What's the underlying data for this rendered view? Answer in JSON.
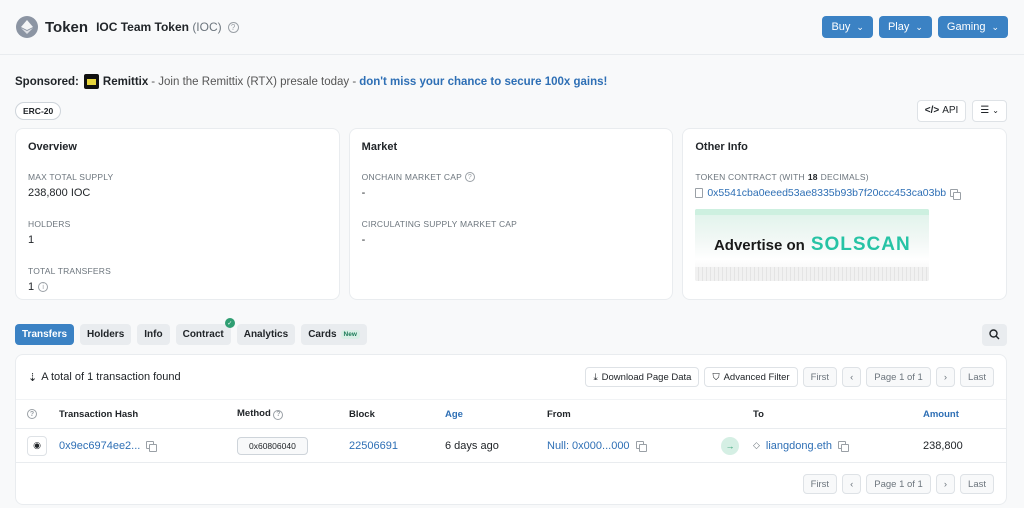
{
  "header": {
    "title": "Token",
    "token_name": "IOC Team Token",
    "symbol": "(IOC)",
    "buttons": [
      "Buy",
      "Play",
      "Gaming"
    ]
  },
  "sponsored": {
    "label": "Sponsored:",
    "brand": "Remittix",
    "text": "- Join the Remittix (RTX) presale today -",
    "link": "don't miss your chance to secure 100x gains!"
  },
  "badges": {
    "standard": "ERC-20",
    "api": "API"
  },
  "overview": {
    "title": "Overview",
    "max_supply_label": "MAX TOTAL SUPPLY",
    "max_supply": "238,800 IOC",
    "holders_label": "HOLDERS",
    "holders": "1",
    "transfers_label": "TOTAL TRANSFERS",
    "transfers": "1"
  },
  "market": {
    "title": "Market",
    "onchain_label": "ONCHAIN MARKET CAP",
    "onchain": "-",
    "circ_label": "CIRCULATING SUPPLY MARKET CAP",
    "circ": "-"
  },
  "other": {
    "title": "Other Info",
    "contract_label_pre": "TOKEN CONTRACT (WITH",
    "decimals": "18",
    "contract_label_post": "DECIMALS)",
    "contract": "0x5541cba0eeed53ae8335b93b7f20ccc453ca03bb",
    "ad_text": "Advertise on",
    "ad_brand": "SOLSCAN"
  },
  "tabs": [
    "Transfers",
    "Holders",
    "Info",
    "Contract",
    "Analytics",
    "Cards"
  ],
  "tab_new_badge": "New",
  "table": {
    "total": "A total of 1 transaction found",
    "download": "Download Page Data",
    "filter": "Advanced Filter",
    "first": "First",
    "last": "Last",
    "page": "Page 1 of 1",
    "headers": {
      "hash": "Transaction Hash",
      "method": "Method",
      "block": "Block",
      "age": "Age",
      "from": "From",
      "to": "To",
      "amount": "Amount"
    },
    "row": {
      "hash": "0x9ec6974ee2...",
      "method": "0x60806040",
      "block": "22506691",
      "age": "6 days ago",
      "from": "Null: 0x000...000",
      "to": "liangdong.eth",
      "amount": "238,800"
    }
  }
}
